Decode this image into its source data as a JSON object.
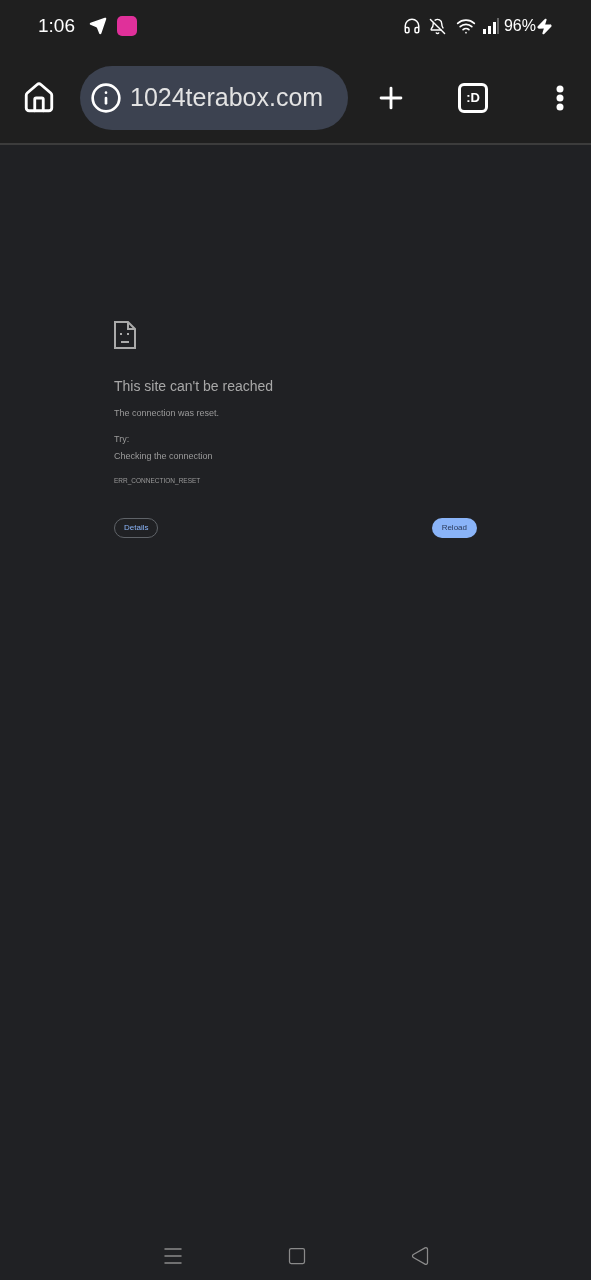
{
  "status_bar": {
    "time": "1:06",
    "battery": "96%"
  },
  "toolbar": {
    "url": "1024terabox.com",
    "tab_count": ":D"
  },
  "error_page": {
    "title": "This site can't be reached",
    "message": "The connection was reset.",
    "try_label": "Try:",
    "suggestions": [
      "Checking the connection"
    ],
    "error_code": "ERR_CONNECTION_RESET",
    "buttons": [
      {
        "label": "Details",
        "kind": "secondary"
      },
      {
        "label": "Reload",
        "kind": "primary"
      }
    ]
  }
}
